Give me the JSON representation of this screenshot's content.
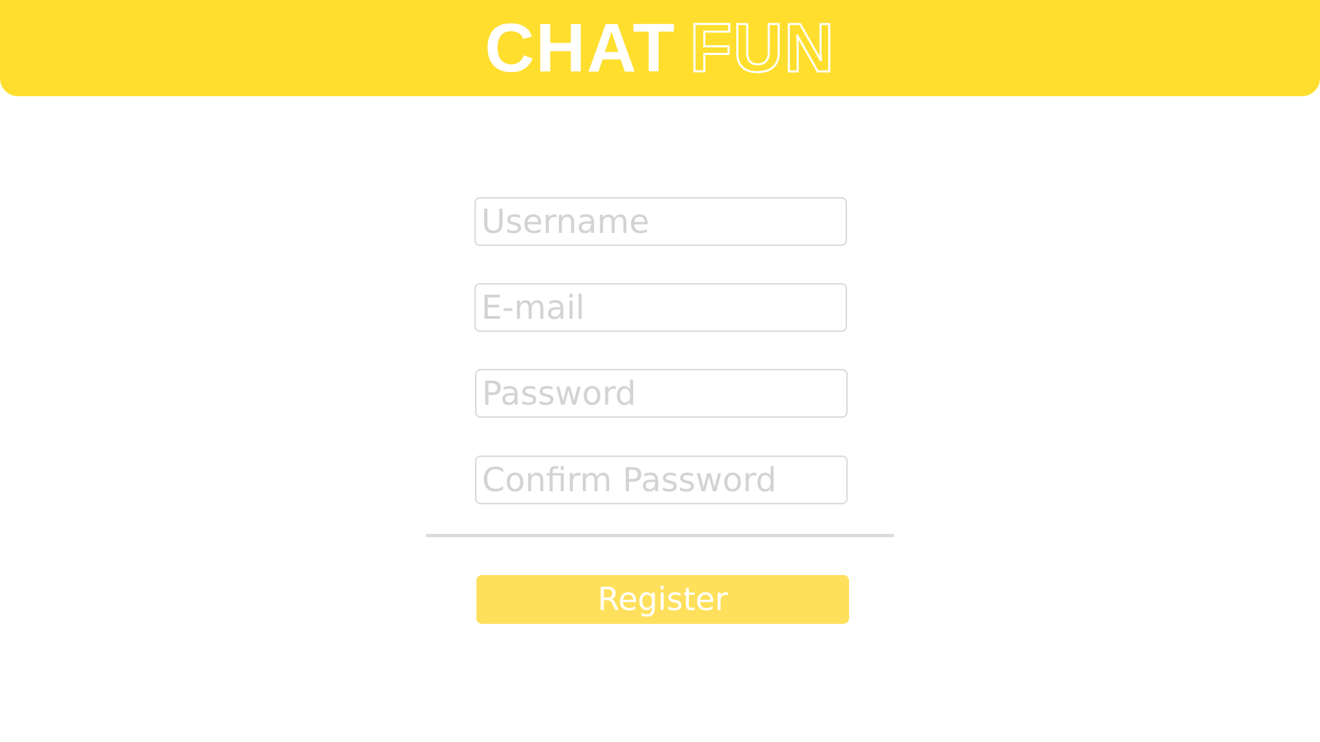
{
  "header": {
    "logo_part1": "CHAT",
    "logo_part2": "FUN"
  },
  "form": {
    "username_placeholder": "Username",
    "email_placeholder": "E-mail",
    "password_placeholder": "Password",
    "confirm_password_placeholder": "Confirm Password",
    "register_label": "Register"
  },
  "colors": {
    "brand_yellow": "#FFDE2E",
    "button_yellow": "#FFE05C",
    "field_border": "#d9d9d9",
    "placeholder_gray": "#d3d3d3"
  }
}
